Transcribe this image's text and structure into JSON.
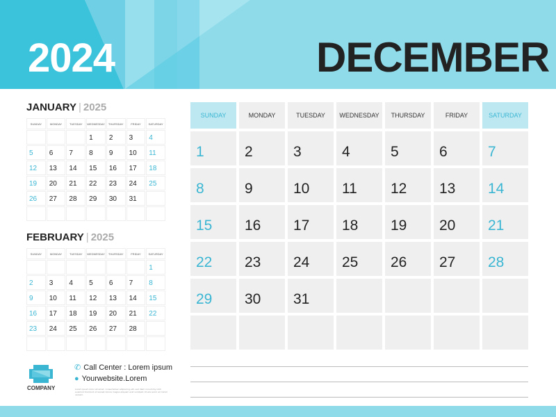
{
  "header": {
    "year": "2024",
    "month": "DECEMBER"
  },
  "days_full": [
    "SUNDAY",
    "MONDAY",
    "TUESDAY",
    "WEDNESDAY",
    "THURSDAY",
    "FRIDAY",
    "SATURDAY"
  ],
  "days_mini": [
    "SUNDAY",
    "MONDAY",
    "TUESDAY",
    "WEDNESDAY",
    "THURSDAY",
    "FRIDAY",
    "SATURDAY"
  ],
  "main_calendar": {
    "cells": [
      "1",
      "2",
      "3",
      "4",
      "5",
      "6",
      "7",
      "8",
      "9",
      "10",
      "11",
      "12",
      "13",
      "14",
      "15",
      "16",
      "17",
      "18",
      "19",
      "20",
      "21",
      "22",
      "23",
      "24",
      "25",
      "26",
      "27",
      "28",
      "29",
      "30",
      "31",
      "",
      "",
      "",
      "",
      "",
      "",
      "",
      "",
      "",
      "",
      "",
      ""
    ]
  },
  "january": {
    "name": "JANUARY",
    "year": "2025",
    "cells": [
      "",
      "",
      "",
      "1",
      "2",
      "3",
      "4",
      "5",
      "6",
      "7",
      "8",
      "9",
      "10",
      "11",
      "12",
      "13",
      "14",
      "15",
      "16",
      "17",
      "18",
      "19",
      "20",
      "21",
      "22",
      "23",
      "24",
      "25",
      "26",
      "27",
      "28",
      "29",
      "30",
      "31",
      "",
      "",
      "",
      "",
      "",
      "",
      "",
      ""
    ]
  },
  "february": {
    "name": "FEBRUARY",
    "year": "2025",
    "cells": [
      "",
      "",
      "",
      "",
      "",
      "",
      "1",
      "2",
      "3",
      "4",
      "5",
      "6",
      "7",
      "8",
      "9",
      "10",
      "11",
      "12",
      "13",
      "14",
      "15",
      "16",
      "17",
      "18",
      "19",
      "20",
      "21",
      "22",
      "23",
      "24",
      "25",
      "26",
      "27",
      "28",
      "",
      "",
      "",
      "",
      "",
      "",
      "",
      ""
    ]
  },
  "footer": {
    "company": "COMPANY",
    "call_center": "Call Center : Lorem ipsum",
    "website": "Yourwebsite.Lorem",
    "fine_print": "Lorem ipsum dolor sit amet, consectetuer adipiscing elit, sed diam nonummy nibh euismod tincidunt ut laoreet dolore magna aliquam erat volutpat. Ut wisi enim ad minim veniam."
  },
  "colors": {
    "accent": "#3ab6d3",
    "light_accent": "#8fdbea",
    "cell_bg": "#efefef"
  }
}
